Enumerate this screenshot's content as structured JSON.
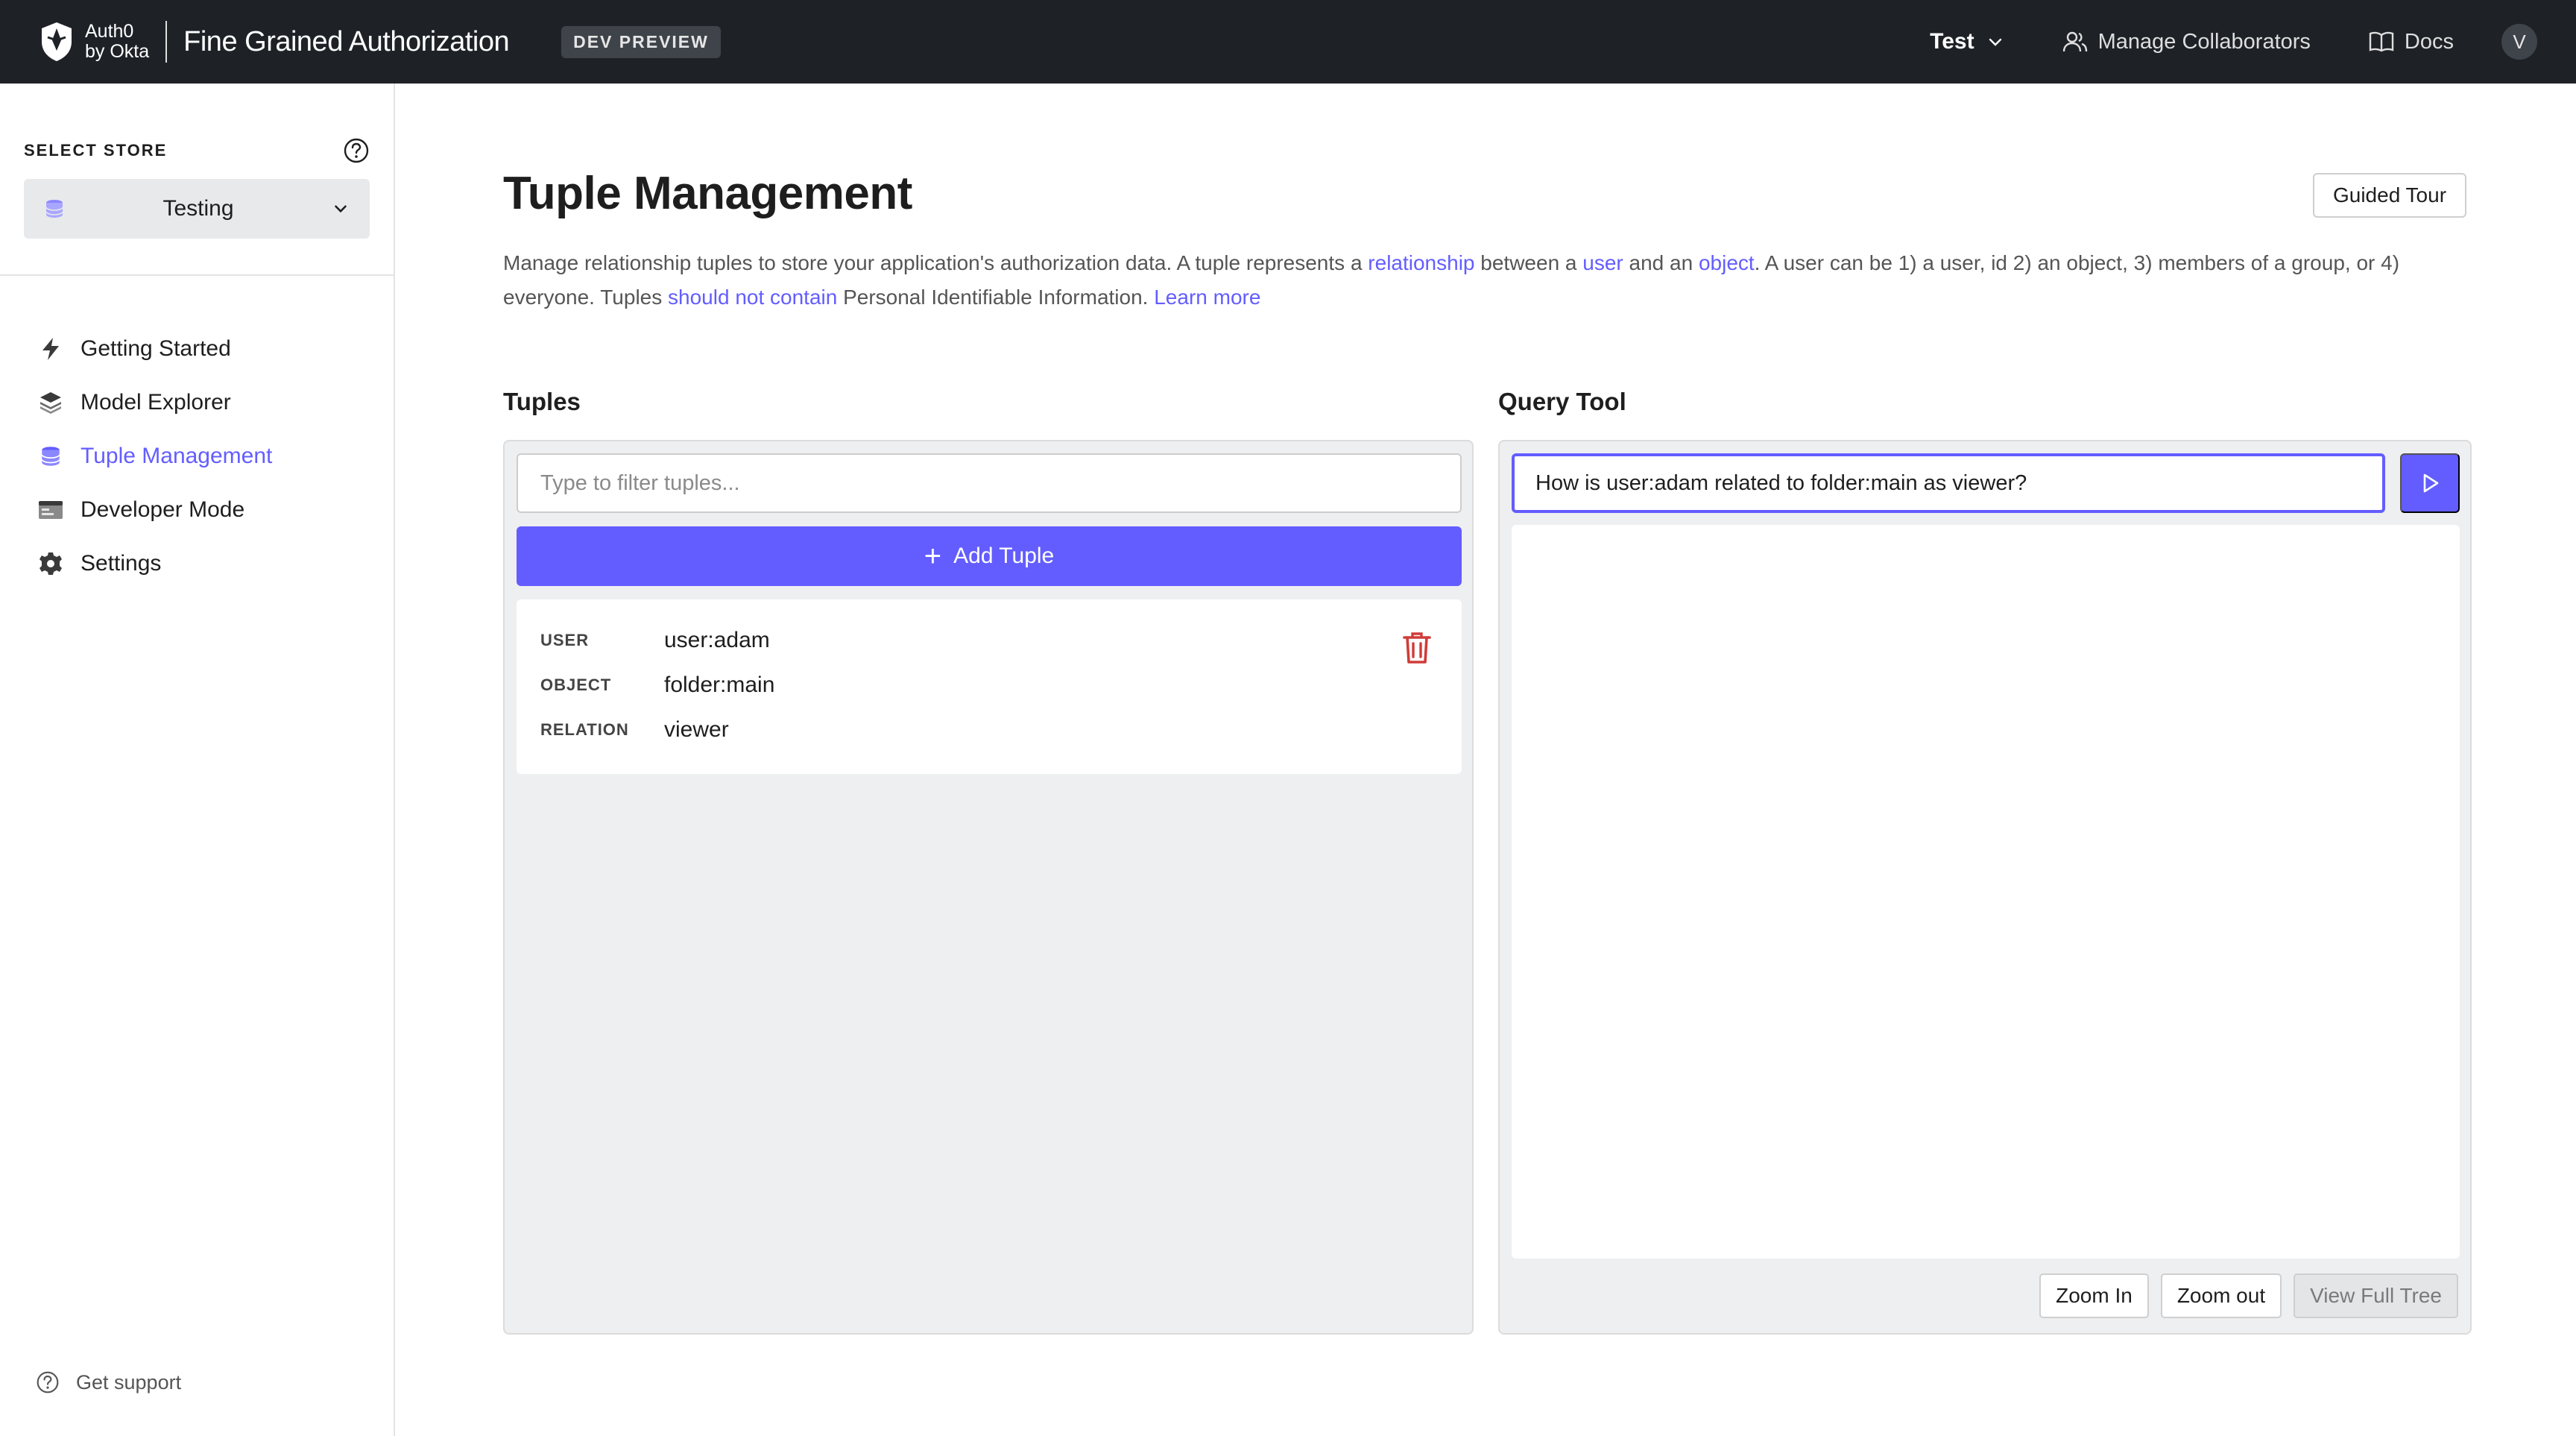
{
  "header": {
    "brand_line1": "Auth0",
    "brand_line2": "by Okta",
    "app_title": "Fine Grained Authorization",
    "badge": "DEV PREVIEW",
    "environment": "Test",
    "collaborators_label": "Manage Collaborators",
    "docs_label": "Docs",
    "avatar_initial": "V"
  },
  "sidebar": {
    "store_label": "SELECT STORE",
    "store_value": "Testing",
    "items": [
      {
        "label": "Getting Started",
        "icon": "bolt-icon"
      },
      {
        "label": "Model Explorer",
        "icon": "layers-icon"
      },
      {
        "label": "Tuple Management",
        "icon": "database-icon",
        "active": true
      },
      {
        "label": "Developer Mode",
        "icon": "terminal-icon"
      },
      {
        "label": "Settings",
        "icon": "gear-icon"
      }
    ],
    "support_label": "Get support"
  },
  "main": {
    "title": "Tuple Management",
    "tour_button": "Guided Tour",
    "description": {
      "p1": "Manage relationship tuples to store your application's authorization data. A tuple represents a ",
      "link_relationship": "relationship",
      "p2": " between a ",
      "link_user": "user",
      "p3": " and an ",
      "link_object": "object",
      "p4": ". A user can be 1) a user, id 2) an object, 3) members of a group, or 4) everyone. Tuples ",
      "link_should_not": "should not contain",
      "p5": " Personal Identifiable Information. ",
      "link_learn": "Learn more"
    },
    "tuples": {
      "title": "Tuples",
      "filter_placeholder": "Type to filter tuples...",
      "add_button": "Add Tuple",
      "items": [
        {
          "user_key": "USER",
          "user": "user:adam",
          "object_key": "OBJECT",
          "object": "folder:main",
          "relation_key": "RELATION",
          "relation": "viewer"
        }
      ]
    },
    "query": {
      "title": "Query Tool",
      "input_value": "How is user:adam related to folder:main as viewer?",
      "zoom_in": "Zoom In",
      "zoom_out": "Zoom out",
      "view_full_tree": "View Full Tree"
    }
  },
  "colors": {
    "accent": "#635dff",
    "topbar": "#1e2227",
    "danger": "#d03c38"
  }
}
